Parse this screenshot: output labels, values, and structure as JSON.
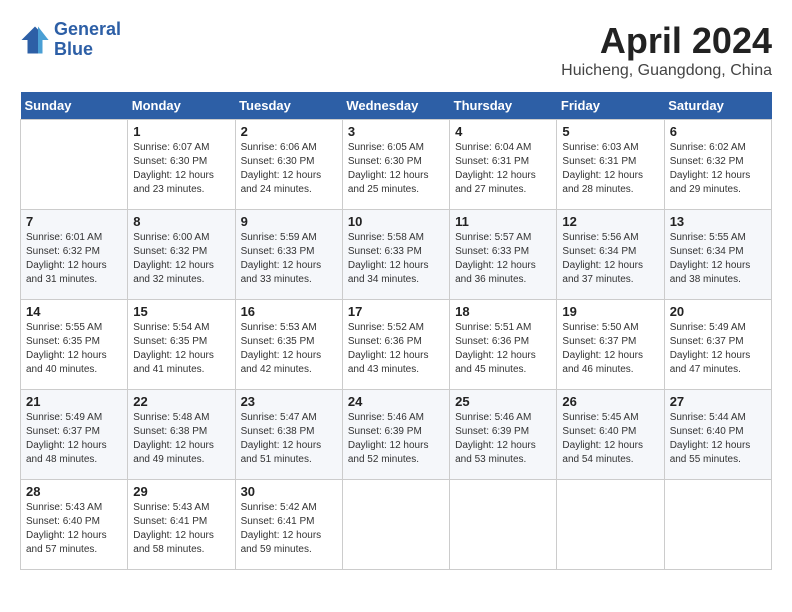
{
  "logo": {
    "general": "General",
    "blue": "Blue"
  },
  "title": "April 2024",
  "location": "Huicheng, Guangdong, China",
  "days_of_week": [
    "Sunday",
    "Monday",
    "Tuesday",
    "Wednesday",
    "Thursday",
    "Friday",
    "Saturday"
  ],
  "weeks": [
    [
      {
        "day": "",
        "sunrise": "",
        "sunset": "",
        "daylight": ""
      },
      {
        "day": "1",
        "sunrise": "Sunrise: 6:07 AM",
        "sunset": "Sunset: 6:30 PM",
        "daylight": "Daylight: 12 hours and 23 minutes."
      },
      {
        "day": "2",
        "sunrise": "Sunrise: 6:06 AM",
        "sunset": "Sunset: 6:30 PM",
        "daylight": "Daylight: 12 hours and 24 minutes."
      },
      {
        "day": "3",
        "sunrise": "Sunrise: 6:05 AM",
        "sunset": "Sunset: 6:30 PM",
        "daylight": "Daylight: 12 hours and 25 minutes."
      },
      {
        "day": "4",
        "sunrise": "Sunrise: 6:04 AM",
        "sunset": "Sunset: 6:31 PM",
        "daylight": "Daylight: 12 hours and 27 minutes."
      },
      {
        "day": "5",
        "sunrise": "Sunrise: 6:03 AM",
        "sunset": "Sunset: 6:31 PM",
        "daylight": "Daylight: 12 hours and 28 minutes."
      },
      {
        "day": "6",
        "sunrise": "Sunrise: 6:02 AM",
        "sunset": "Sunset: 6:32 PM",
        "daylight": "Daylight: 12 hours and 29 minutes."
      }
    ],
    [
      {
        "day": "7",
        "sunrise": "Sunrise: 6:01 AM",
        "sunset": "Sunset: 6:32 PM",
        "daylight": "Daylight: 12 hours and 31 minutes."
      },
      {
        "day": "8",
        "sunrise": "Sunrise: 6:00 AM",
        "sunset": "Sunset: 6:32 PM",
        "daylight": "Daylight: 12 hours and 32 minutes."
      },
      {
        "day": "9",
        "sunrise": "Sunrise: 5:59 AM",
        "sunset": "Sunset: 6:33 PM",
        "daylight": "Daylight: 12 hours and 33 minutes."
      },
      {
        "day": "10",
        "sunrise": "Sunrise: 5:58 AM",
        "sunset": "Sunset: 6:33 PM",
        "daylight": "Daylight: 12 hours and 34 minutes."
      },
      {
        "day": "11",
        "sunrise": "Sunrise: 5:57 AM",
        "sunset": "Sunset: 6:33 PM",
        "daylight": "Daylight: 12 hours and 36 minutes."
      },
      {
        "day": "12",
        "sunrise": "Sunrise: 5:56 AM",
        "sunset": "Sunset: 6:34 PM",
        "daylight": "Daylight: 12 hours and 37 minutes."
      },
      {
        "day": "13",
        "sunrise": "Sunrise: 5:55 AM",
        "sunset": "Sunset: 6:34 PM",
        "daylight": "Daylight: 12 hours and 38 minutes."
      }
    ],
    [
      {
        "day": "14",
        "sunrise": "Sunrise: 5:55 AM",
        "sunset": "Sunset: 6:35 PM",
        "daylight": "Daylight: 12 hours and 40 minutes."
      },
      {
        "day": "15",
        "sunrise": "Sunrise: 5:54 AM",
        "sunset": "Sunset: 6:35 PM",
        "daylight": "Daylight: 12 hours and 41 minutes."
      },
      {
        "day": "16",
        "sunrise": "Sunrise: 5:53 AM",
        "sunset": "Sunset: 6:35 PM",
        "daylight": "Daylight: 12 hours and 42 minutes."
      },
      {
        "day": "17",
        "sunrise": "Sunrise: 5:52 AM",
        "sunset": "Sunset: 6:36 PM",
        "daylight": "Daylight: 12 hours and 43 minutes."
      },
      {
        "day": "18",
        "sunrise": "Sunrise: 5:51 AM",
        "sunset": "Sunset: 6:36 PM",
        "daylight": "Daylight: 12 hours and 45 minutes."
      },
      {
        "day": "19",
        "sunrise": "Sunrise: 5:50 AM",
        "sunset": "Sunset: 6:37 PM",
        "daylight": "Daylight: 12 hours and 46 minutes."
      },
      {
        "day": "20",
        "sunrise": "Sunrise: 5:49 AM",
        "sunset": "Sunset: 6:37 PM",
        "daylight": "Daylight: 12 hours and 47 minutes."
      }
    ],
    [
      {
        "day": "21",
        "sunrise": "Sunrise: 5:49 AM",
        "sunset": "Sunset: 6:37 PM",
        "daylight": "Daylight: 12 hours and 48 minutes."
      },
      {
        "day": "22",
        "sunrise": "Sunrise: 5:48 AM",
        "sunset": "Sunset: 6:38 PM",
        "daylight": "Daylight: 12 hours and 49 minutes."
      },
      {
        "day": "23",
        "sunrise": "Sunrise: 5:47 AM",
        "sunset": "Sunset: 6:38 PM",
        "daylight": "Daylight: 12 hours and 51 minutes."
      },
      {
        "day": "24",
        "sunrise": "Sunrise: 5:46 AM",
        "sunset": "Sunset: 6:39 PM",
        "daylight": "Daylight: 12 hours and 52 minutes."
      },
      {
        "day": "25",
        "sunrise": "Sunrise: 5:46 AM",
        "sunset": "Sunset: 6:39 PM",
        "daylight": "Daylight: 12 hours and 53 minutes."
      },
      {
        "day": "26",
        "sunrise": "Sunrise: 5:45 AM",
        "sunset": "Sunset: 6:40 PM",
        "daylight": "Daylight: 12 hours and 54 minutes."
      },
      {
        "day": "27",
        "sunrise": "Sunrise: 5:44 AM",
        "sunset": "Sunset: 6:40 PM",
        "daylight": "Daylight: 12 hours and 55 minutes."
      }
    ],
    [
      {
        "day": "28",
        "sunrise": "Sunrise: 5:43 AM",
        "sunset": "Sunset: 6:40 PM",
        "daylight": "Daylight: 12 hours and 57 minutes."
      },
      {
        "day": "29",
        "sunrise": "Sunrise: 5:43 AM",
        "sunset": "Sunset: 6:41 PM",
        "daylight": "Daylight: 12 hours and 58 minutes."
      },
      {
        "day": "30",
        "sunrise": "Sunrise: 5:42 AM",
        "sunset": "Sunset: 6:41 PM",
        "daylight": "Daylight: 12 hours and 59 minutes."
      },
      {
        "day": "",
        "sunrise": "",
        "sunset": "",
        "daylight": ""
      },
      {
        "day": "",
        "sunrise": "",
        "sunset": "",
        "daylight": ""
      },
      {
        "day": "",
        "sunrise": "",
        "sunset": "",
        "daylight": ""
      },
      {
        "day": "",
        "sunrise": "",
        "sunset": "",
        "daylight": ""
      }
    ]
  ]
}
